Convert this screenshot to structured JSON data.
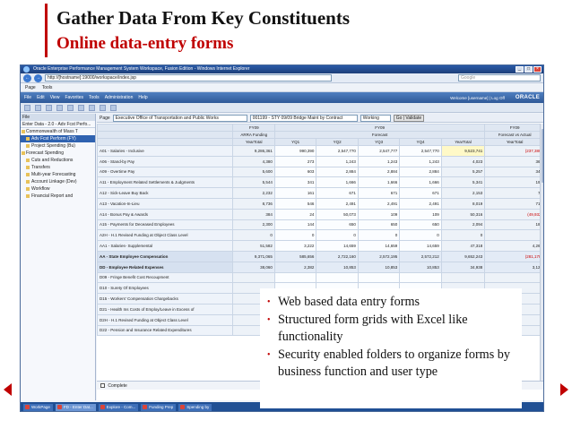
{
  "slide": {
    "title": "Gather Data From Key Constituents",
    "subtitle": "Online  data-entry forms",
    "accent_color": "#c00000"
  },
  "browser": {
    "window_title": "Oracle Enterprise Performance Management System Workspace, Fusion Edition - Windows Internet Explorer",
    "address": "http://[hostname]:19000/workspace/index.jsp",
    "search_placeholder": "Google",
    "nav_back": "←",
    "nav_forward": "→",
    "command_items": [
      "Page",
      "Tools"
    ],
    "window_controls": [
      "_",
      "□",
      "×"
    ]
  },
  "app": {
    "menu": [
      "File",
      "Edit",
      "View",
      "Favorites",
      "Tools",
      "Administration",
      "Help"
    ],
    "user_text": "Welcome [username] | Log Off",
    "logo": "ORACLE"
  },
  "sidebar": {
    "header": "File",
    "header2": "Enter Data - 2.0 - Adv Fcst Perfo...",
    "items": [
      {
        "label": "Commonwealth of Mass T",
        "level": 1,
        "selected": false
      },
      {
        "label": "Adv Fcst Perform (FY)",
        "level": 2,
        "selected": true
      },
      {
        "label": "Project Spending (Bu)",
        "level": 2,
        "selected": false
      },
      {
        "label": "Forecast Spending",
        "level": 1,
        "selected": false
      },
      {
        "label": "Cuts and Reductions",
        "level": 2,
        "selected": false
      },
      {
        "label": "Transfers",
        "level": 2,
        "selected": false
      },
      {
        "label": "Multi-year Forecasting",
        "level": 2,
        "selected": false
      },
      {
        "label": "Account Linkage (Dev)",
        "level": 2,
        "selected": false
      },
      {
        "label": "Workflow",
        "level": 2,
        "selected": false
      },
      {
        "label": "Financial Report and",
        "level": 2,
        "selected": false
      }
    ]
  },
  "page_selector": {
    "label": "Page",
    "dept": "Executive Office of Transportation and Public Works",
    "account": "001199 - STY 09/09 Bridge Maint by Contract",
    "version": "Working",
    "go": "Go | Validate"
  },
  "grid": {
    "col_headers_top": [
      "FY09",
      "FY09",
      "FY09"
    ],
    "col_headers_mid": [
      "ARRA Funding",
      "Forecast",
      "Forecast vs Actual"
    ],
    "col_headers_bottom": [
      "YearTotal",
      "YQ1",
      "YQ2",
      "YQ3",
      "YQ4",
      "YearTotal",
      "YearTotal"
    ],
    "rows": [
      {
        "label": "A01 - Salaries - Inclusive",
        "values": [
          "9,286,361",
          "990,390",
          "2,547,770",
          "2,547,777",
          "2,547,770",
          "9,523,741",
          "(237,380)"
        ],
        "sub": false
      },
      {
        "label": "A06 - Stand-by Pay",
        "values": [
          "4,380",
          "273",
          "1,243",
          "1,243",
          "1,243",
          "4,023",
          "363"
        ],
        "sub": false
      },
      {
        "label": "A09 - Overtime Pay",
        "values": [
          "5,600",
          "603",
          "2,884",
          "2,884",
          "2,884",
          "5,257",
          "343"
        ],
        "sub": false
      },
      {
        "label": "A11 - Employment Related Settlements & Judgments",
        "values": [
          "5,544",
          "341",
          "1,666",
          "1,666",
          "1,666",
          "5,341",
          "198"
        ],
        "sub": false
      },
      {
        "label": "A12 - Sick-Leave Buy Back",
        "values": [
          "2,232",
          "161",
          "671",
          "671",
          "671",
          "2,153",
          "79"
        ],
        "sub": false
      },
      {
        "label": "A13 - Vacation-In-Lieu",
        "values": [
          "8,736",
          "546",
          "2,491",
          "2,491",
          "2,491",
          "8,019",
          "717"
        ],
        "sub": false
      },
      {
        "label": "A14 - Bonus Pay & Awards",
        "values": [
          "384",
          "24",
          "50,073",
          "109",
          "109",
          "50,316",
          "(49,932)"
        ],
        "sub": false
      },
      {
        "label": "A15 - Payments for Deceased Employees",
        "values": [
          "2,300",
          "144",
          "650",
          "650",
          "650",
          "2,094",
          "186"
        ],
        "sub": false
      },
      {
        "label": "A2H - H.1 Revised Funding at Object Class Level",
        "values": [
          "0",
          "0",
          "0",
          "0",
          "0",
          "0",
          "0"
        ],
        "sub": false
      },
      {
        "label": "AA1 - Salaries- Supplemental",
        "values": [
          "51,582",
          "3,222",
          "14,659",
          "14,659",
          "14,659",
          "47,318",
          "4,264"
        ],
        "sub": false
      },
      {
        "label": "AA - State Employee Compensation",
        "values": [
          "9,371,065",
          "585,656",
          "2,722,160",
          "2,572,195",
          "2,572,212",
          "9,652,243",
          "(281,178)"
        ],
        "sub": true
      },
      {
        "label": "DD - Employee Related Expenses",
        "values": [
          "38,060",
          "2,382",
          "10,853",
          "10,853",
          "10,853",
          "34,938",
          "3,122"
        ],
        "sub": true
      },
      {
        "label": "D09 - Fringe Benefit Cost Recoupment",
        "values": [
          "",
          "",
          "",
          "",
          "",
          "",
          ""
        ],
        "sub": false
      },
      {
        "label": "D10 - Surety Of Employees",
        "values": [
          "",
          "",
          "",
          "",
          "",
          "",
          ""
        ],
        "sub": false
      },
      {
        "label": "D15 - Workers' Compensation Chargebacks",
        "values": [
          "",
          "",
          "",
          "",
          "",
          "",
          ""
        ],
        "sub": false
      },
      {
        "label": "D21 - Health Ins Costs of Employ/Leave in Excess of",
        "values": [
          "",
          "",
          "",
          "",
          "",
          "",
          ""
        ],
        "sub": false
      },
      {
        "label": "D2H - H.1 Revised Funding at Object Class Level",
        "values": [
          "",
          "",
          "",
          "",
          "",
          "",
          ""
        ],
        "sub": false
      },
      {
        "label": "D22 - Pension and Insurance Related Expenditures",
        "values": [
          "",
          "",
          "",
          "",
          "",
          "",
          ""
        ],
        "sub": false
      }
    ],
    "complete_label": "Complete"
  },
  "taskbar": {
    "items": [
      {
        "label": "WorkPage",
        "active": false
      },
      {
        "label": "FD - Enter Dat...",
        "active": true
      },
      {
        "label": "Explore - Com...",
        "active": false
      },
      {
        "label": "Funding Prep",
        "active": false
      },
      {
        "label": "Spending by",
        "active": false
      }
    ]
  },
  "callout": {
    "bullets": [
      "Web based data entry forms",
      "Structured form grids with Excel like functionality",
      "Security enabled folders to organize forms by business function and user type"
    ]
  }
}
